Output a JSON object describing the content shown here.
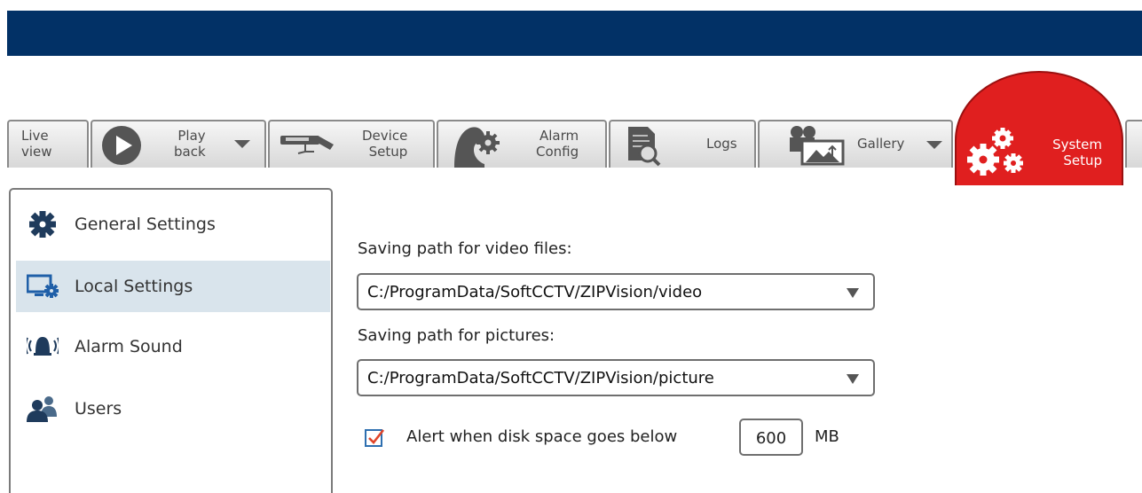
{
  "tabs": {
    "live": [
      "Live",
      "view"
    ],
    "playback": [
      "Play",
      "back"
    ],
    "device": [
      "Device",
      "Setup"
    ],
    "alarm": [
      "Alarm",
      "Config"
    ],
    "logs": "Logs",
    "gallery": "Gallery",
    "system": [
      "System",
      "Setup"
    ]
  },
  "sidebar": {
    "items": [
      {
        "label": "General Settings",
        "icon": "gear-icon"
      },
      {
        "label": "Local Settings",
        "icon": "monitor-gear-icon",
        "active": true
      },
      {
        "label": "Alarm Sound",
        "icon": "alarm-bell-icon"
      },
      {
        "label": "Users",
        "icon": "users-icon"
      }
    ]
  },
  "local": {
    "video_label": "Saving path for video files:",
    "video_path": "C:/ProgramData/SoftCCTV/ZIPVision/video",
    "picture_label": "Saving path for pictures:",
    "picture_path": "C:/ProgramData/SoftCCTV/ZIPVision/picture",
    "alert_label": "Alert when disk space goes below",
    "alert_checked": true,
    "alert_value": "600",
    "alert_unit": "MB"
  },
  "colors": {
    "topbar": "#023166",
    "active_tab": "#e01f1f",
    "active_sidebar": "#d9e4ec"
  }
}
